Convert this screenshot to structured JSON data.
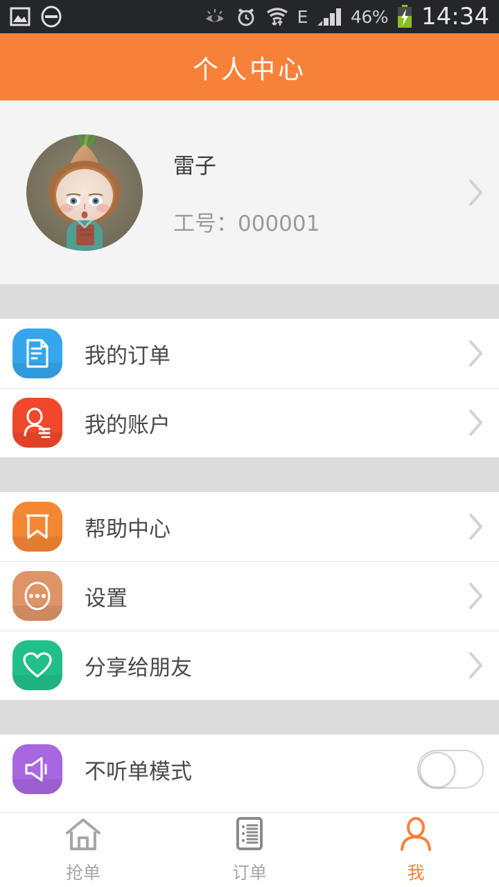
{
  "status_bar": {
    "icons_left": [
      "image-icon",
      "do-not-disturb-icon"
    ],
    "icons_right": [
      "eye-icon",
      "alarm-clock-icon",
      "wifi-data-transfer-icon"
    ],
    "network_type": "E",
    "signal": "signal-bars-icon",
    "battery_percent": "46%",
    "battery_state": "battery-charging-icon",
    "clock": "14:34"
  },
  "header": {
    "title": "个人中心"
  },
  "profile": {
    "avatar_alt": "avatar",
    "name": "雷子",
    "employee_id_label": "工号：000001",
    "chevron": "chevron-right-icon"
  },
  "menu_groups": [
    {
      "items": [
        {
          "label": "我的订单",
          "icon": "document-icon",
          "icon_color": "#35a6eb",
          "chevron": "chevron-right-icon"
        },
        {
          "label": "我的账户",
          "icon": "account-person-icon",
          "icon_color": "#f0482a",
          "chevron": "chevron-right-icon"
        }
      ]
    },
    {
      "items": [
        {
          "label": "帮助中心",
          "icon": "bookmark-icon",
          "icon_color": "#f58634",
          "chevron": "chevron-right-icon"
        },
        {
          "label": "设置",
          "icon": "settings-dots-icon",
          "icon_color": "#dd9467",
          "chevron": "chevron-right-icon"
        },
        {
          "label": "分享给朋友",
          "icon": "heart-icon",
          "icon_color": "#22bf8a",
          "chevron": "chevron-right-icon"
        }
      ]
    },
    {
      "items": [
        {
          "label": "不听单模式",
          "icon": "speaker-icon",
          "icon_color": "#a濃",
          "chevron": "toggle-switch",
          "toggle_state": "off"
        }
      ]
    }
  ],
  "mute_row": {
    "label": "不听单模式",
    "icon": "speaker-icon",
    "icon_color": "#a767e0",
    "toggle_state": "off"
  },
  "bottom_nav": [
    {
      "label": "抢单",
      "icon": "home-icon",
      "active": false
    },
    {
      "label": "订单",
      "icon": "list-icon",
      "active": false
    },
    {
      "label": "我",
      "icon": "person-icon",
      "active": true
    }
  ],
  "colors": {
    "accent": "#f8813a",
    "band": "#dcdcdc",
    "profile_bg": "#f4f4f4",
    "status_bg": "#25262a",
    "text_primary": "#4a4a4a",
    "text_muted": "#9a9a9a"
  }
}
